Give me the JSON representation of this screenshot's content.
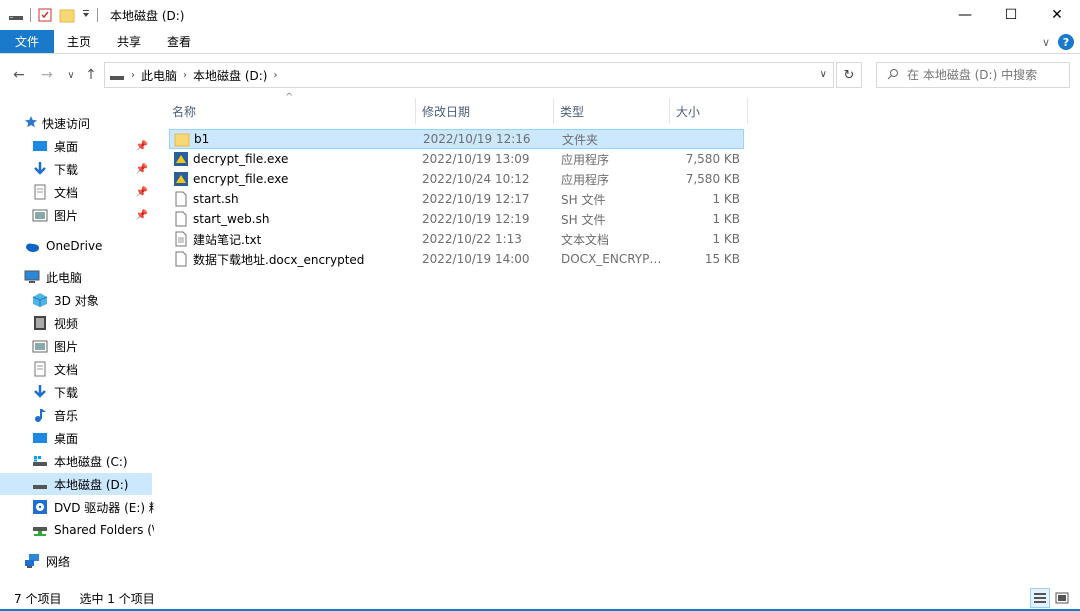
{
  "window": {
    "title": "本地磁盘 (D:)",
    "controls": {
      "minimize": "—",
      "maximize": "☐",
      "close": "✕"
    }
  },
  "ribbon": {
    "tabs": [
      "文件",
      "主页",
      "共享",
      "查看"
    ],
    "expand": "∨",
    "help": "?"
  },
  "nav": {
    "back": "←",
    "forward": "→",
    "recent": "∨",
    "up": "↑",
    "breadcrumb": [
      "此电脑",
      "本地磁盘 (D:)"
    ],
    "refresh": "↻",
    "search_placeholder": "在 本地磁盘 (D:) 中搜索"
  },
  "sidebar": {
    "quick_access": "快速访问",
    "quick_items": [
      {
        "label": "桌面",
        "icon": "desktop-icon"
      },
      {
        "label": "下载",
        "icon": "download-icon"
      },
      {
        "label": "文档",
        "icon": "document-icon"
      },
      {
        "label": "图片",
        "icon": "pictures-icon"
      }
    ],
    "onedrive": "OneDrive",
    "this_pc": "此电脑",
    "pc_items": [
      {
        "label": "3D 对象",
        "icon": "3d-objects-icon"
      },
      {
        "label": "视频",
        "icon": "video-icon"
      },
      {
        "label": "图片",
        "icon": "pictures-icon"
      },
      {
        "label": "文档",
        "icon": "document-icon"
      },
      {
        "label": "下载",
        "icon": "download-icon"
      },
      {
        "label": "音乐",
        "icon": "music-icon"
      },
      {
        "label": "桌面",
        "icon": "desktop-icon"
      },
      {
        "label": "本地磁盘 (C:)",
        "icon": "drive-c-icon"
      },
      {
        "label": "本地磁盘 (D:)",
        "icon": "drive-d-icon",
        "selected": true
      },
      {
        "label": "DVD 驱动器 (E:) 精",
        "icon": "dvd-drive-icon"
      },
      {
        "label": "Shared Folders (\\\\",
        "icon": "network-share-icon"
      }
    ],
    "network": "网络"
  },
  "columns": {
    "name": "名称",
    "date": "修改日期",
    "type": "类型",
    "size": "大小"
  },
  "files": [
    {
      "name": "b1",
      "date": "2022/10/19 12:16",
      "type": "文件夹",
      "size": "",
      "icon": "folder-icon",
      "selected": true
    },
    {
      "name": "decrypt_file.exe",
      "date": "2022/10/19 13:09",
      "type": "应用程序",
      "size": "7,580 KB",
      "icon": "python-exe-icon"
    },
    {
      "name": "encrypt_file.exe",
      "date": "2022/10/24 10:12",
      "type": "应用程序",
      "size": "7,580 KB",
      "icon": "python-exe-icon"
    },
    {
      "name": "start.sh",
      "date": "2022/10/19 12:17",
      "type": "SH 文件",
      "size": "1 KB",
      "icon": "file-icon"
    },
    {
      "name": "start_web.sh",
      "date": "2022/10/19 12:19",
      "type": "SH 文件",
      "size": "1 KB",
      "icon": "file-icon"
    },
    {
      "name": "建站笔记.txt",
      "date": "2022/10/22 1:13",
      "type": "文本文档",
      "size": "1 KB",
      "icon": "text-file-icon"
    },
    {
      "name": "数据下载地址.docx_encrypted",
      "date": "2022/10/19 14:00",
      "type": "DOCX_ENCRYPT...",
      "size": "15 KB",
      "icon": "file-icon"
    }
  ],
  "status": {
    "count": "7 个项目",
    "selected": "选中 1 个项目"
  },
  "colors": {
    "accent": "#1979ca",
    "selection": "#cce8ff",
    "header_text": "#4c607a"
  }
}
